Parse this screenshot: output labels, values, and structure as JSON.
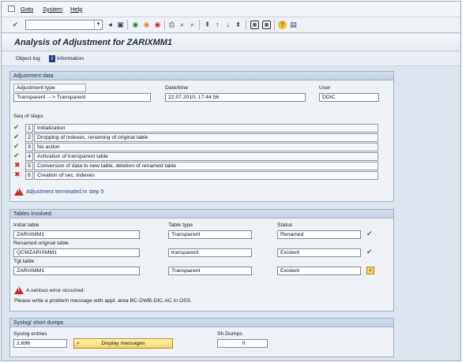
{
  "menu": {
    "items": [
      "Goto",
      "System",
      "Help"
    ]
  },
  "toolbar": {
    "command_placeholder": ""
  },
  "header": {
    "title": "Analysis of Adjustment for ZARIXMM1"
  },
  "apptoolbar": {
    "object_log": "Object log",
    "information": "Information"
  },
  "adjustment": {
    "group_title": "Adjustment data",
    "type_label": "Adjustment type",
    "type_value": "Transparent ---> Transparent",
    "datetime_label": "Date/time",
    "datetime_value": "22.07.2010, 17:44:56",
    "user_label": "User",
    "user_value": "DDIC",
    "seq_label": "Seq of steps",
    "steps": [
      {
        "num": "1",
        "text": "Initialization",
        "status": "ok"
      },
      {
        "num": "2",
        "text": "Dropping of indexes, renaming of original table",
        "status": "ok"
      },
      {
        "num": "3",
        "text": "No action",
        "status": "ok"
      },
      {
        "num": "4",
        "text": "Activation of transparent table",
        "status": "ok"
      },
      {
        "num": "5",
        "text": "Conversion of data to new table, deletion of renamed table",
        "status": "error"
      },
      {
        "num": "6",
        "text": "Creation of sec. indexes",
        "status": "error"
      }
    ],
    "termination_msg": "Adjustment terminated in step 5"
  },
  "tables": {
    "group_title": "Tables involved",
    "col_type": "Table type",
    "col_status": "Status",
    "rows": [
      {
        "label": "Initial table",
        "name": "ZARIXMM1",
        "type": "Transparent",
        "status": "Renamed"
      },
      {
        "label": "Renamed original table",
        "name": "QCMZARIXMM1",
        "type": "transparent",
        "status": "Existent"
      },
      {
        "label": "Tgt.table",
        "name": "ZARIXMM1",
        "type": "Transparent",
        "status": "Existent"
      }
    ],
    "error_title": "A serious error occurred:",
    "error_detail": "Please write a problem message with appl. area BC-DWB-DIC-AC in OSS."
  },
  "syslog": {
    "group_title": "Syslog/ short dumps",
    "entries_label": "Syslog entries",
    "entries_value": "2,696",
    "display_button": "Display messages",
    "dumps_label": "Sh.Dumps",
    "dumps_value": "0"
  }
}
